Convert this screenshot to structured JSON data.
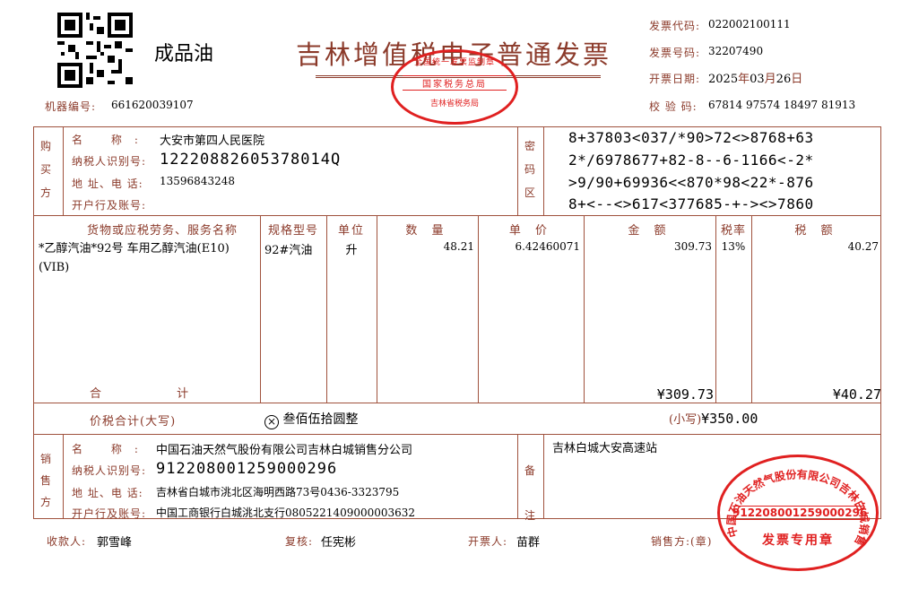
{
  "header": {
    "product_tag": "成品油",
    "title": "吉林增值税电子普通发票",
    "machine_no_label": "机器编号:",
    "machine_no": "661620039107",
    "invoice_code_label": "发票代码:",
    "invoice_code": "022002100111",
    "invoice_no_label": "发票号码:",
    "invoice_no": "32207490",
    "date_label": "开票日期:",
    "date_year": "2025",
    "date_month": "03",
    "date_day": "26",
    "check_label": "校 验 码:",
    "check_code": "67814 97574 18497 81913"
  },
  "buyer": {
    "side_label": "购买方",
    "name_label": "名 称:",
    "name": "大安市第四人民医院",
    "tax_id_label": "纳税人识别号:",
    "tax_id": "12220882605378014Q",
    "addr_label": "地 址、电 话:",
    "addr": "13596843248",
    "bank_label": "开户行及账号:",
    "bank": ""
  },
  "cipher": {
    "label": "密码区",
    "lines": [
      "8+37803<037/*90>72<>8768+63",
      "2*/6978677+82-8--6-1166<-2*",
      ">9/90+69936<<870*98<22*-876",
      "8+<--<>617<377685-+-><>7860"
    ]
  },
  "items_header": {
    "name": "货物或应税劳务、服务名称",
    "spec": "规格型号",
    "unit": "单位",
    "qty": "数 量",
    "price": "单 价",
    "amount": "金 额",
    "rate": "税率",
    "tax": "税 额"
  },
  "items": [
    {
      "name": "*乙醇汽油*92号 车用乙醇汽油(E10)(VIB)",
      "spec": "92#汽油",
      "unit": "升",
      "qty": "48.21",
      "price": "6.42460071",
      "amount": "309.73",
      "rate": "13%",
      "tax": "40.27"
    }
  ],
  "totals": {
    "label": "合 计",
    "amount": "¥309.73",
    "tax": "¥40.27",
    "grand_label": "价税合计(大写)",
    "grand_words": "叁佰伍拾圆整",
    "small_label": "(小写)",
    "grand_number": "¥350.00"
  },
  "seller": {
    "side_label": "销售方",
    "name_label": "名 称:",
    "name": "中国石油天然气股份有限公司吉林白城销售分公司",
    "tax_id_label": "纳税人识别号:",
    "tax_id": "912208001259000296",
    "addr_label": "地 址、电 话:",
    "addr": "吉林省白城市洮北区海明西路73号0436-3323795",
    "bank_label": "开户行及账号:",
    "bank": "中国工商银行白城洮北支行0805221409000003632"
  },
  "remark": {
    "label": "备注",
    "text": "吉林白城大安高速站"
  },
  "footer": {
    "payee_label": "收款人:",
    "payee": "郭雪峰",
    "reviewer_label": "复核:",
    "reviewer": "任宪彬",
    "drawer_label": "开票人:",
    "drawer": "苗群",
    "seller_label": "销售方:(章)"
  },
  "seals": {
    "tax_bureau_top": "全国统一发票监制章",
    "tax_bureau_mid": "国家税务总局",
    "tax_bureau_bottom": "吉林省税务局",
    "seller_ring": "中国石油天然气股份有限公司吉林白城销售分公司",
    "seller_id": "912208001259000296",
    "seller_bottom": "发票专用章"
  },
  "colors": {
    "frame": "#a0523d",
    "label": "#8b3a2a",
    "stamp": "#e02020"
  }
}
